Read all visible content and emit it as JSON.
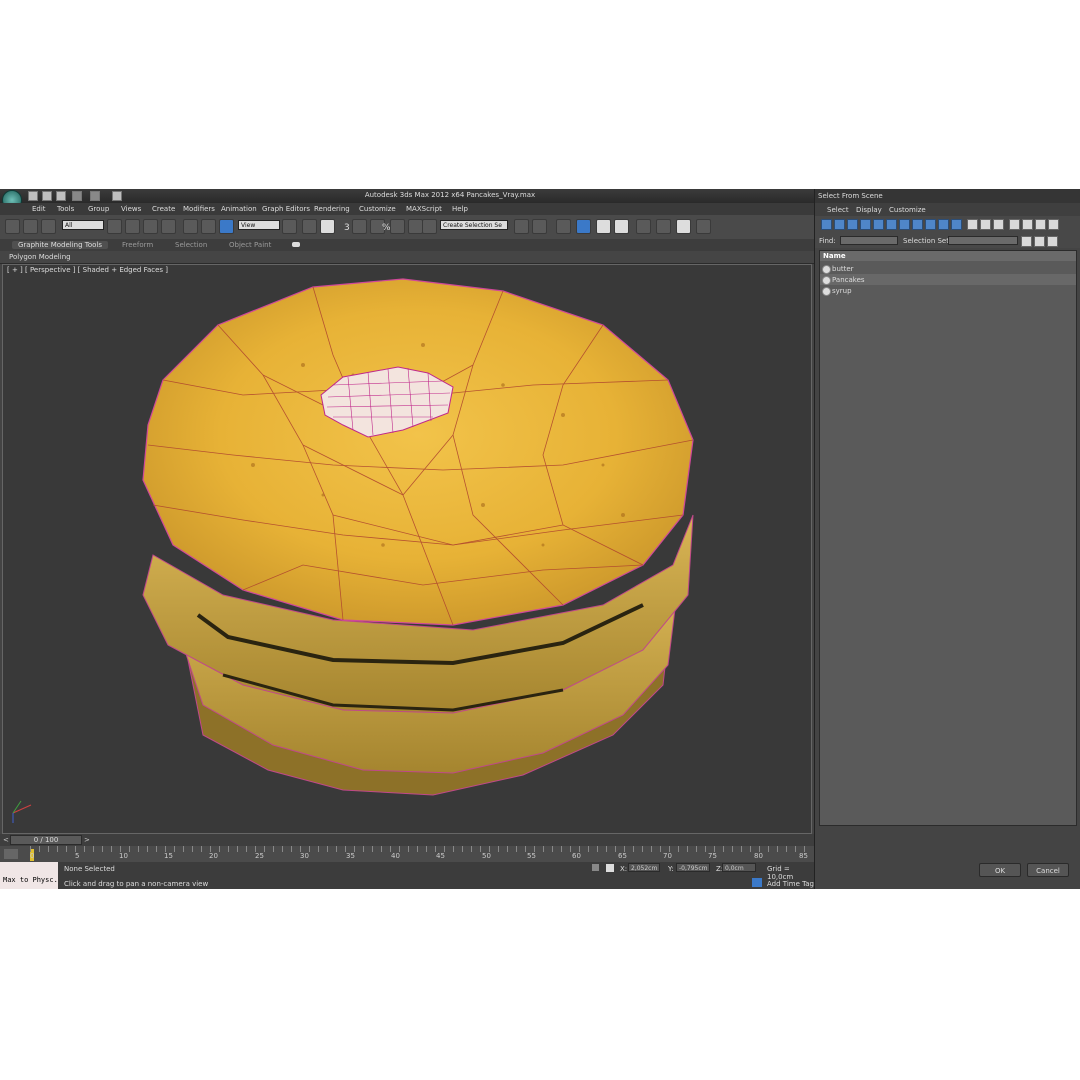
{
  "app": {
    "title": "Autodesk 3ds Max  2012 x64     Pancakes_Vray.max",
    "menu": [
      "Edit",
      "Tools",
      "Group",
      "Views",
      "Create",
      "Modifiers",
      "Animation",
      "Graph Editors",
      "Rendering",
      "Customize",
      "MAXScript",
      "Help"
    ],
    "filter_dropdown": "All",
    "coord_dropdown": "View",
    "selection_set_dropdown": "Create Selection Se",
    "snap_labels": [
      "3",
      "%"
    ],
    "ribbon_tabs": [
      "Graphite Modeling Tools",
      "Freeform",
      "Selection",
      "Object Paint"
    ],
    "ribbon_panel": "Polygon Modeling"
  },
  "viewport": {
    "label": "[ + ] [ Perspective ] [ Shaded + Edged Faces ]"
  },
  "timeline": {
    "frame": "0 / 100",
    "ticks": [
      "0",
      "5",
      "10",
      "15",
      "20",
      "25",
      "30",
      "35",
      "40",
      "45",
      "50",
      "55",
      "60",
      "65",
      "70",
      "75",
      "80",
      "85"
    ]
  },
  "status": {
    "script_label": "Max to Physc.",
    "selection": "None Selected",
    "prompt": "Click and drag to pan a non-camera view",
    "x_label": "X:",
    "x_value": "2,052cm",
    "y_label": "Y:",
    "y_value": "-0,795cm",
    "z_label": "Z:",
    "z_value": "0,0cm",
    "grid": "Grid = 10,0cm",
    "add_time_tag": "Add Time Tag"
  },
  "dialog": {
    "title": "Select From Scene",
    "menu": [
      "Select",
      "Display",
      "Customize"
    ],
    "find_label": "Find:",
    "find_value": "",
    "selection_set_label": "Selection Set:",
    "column_header": "Name",
    "items": [
      "butter",
      "Pancakes",
      "syrup"
    ],
    "ok": "OK",
    "cancel": "Cancel"
  }
}
